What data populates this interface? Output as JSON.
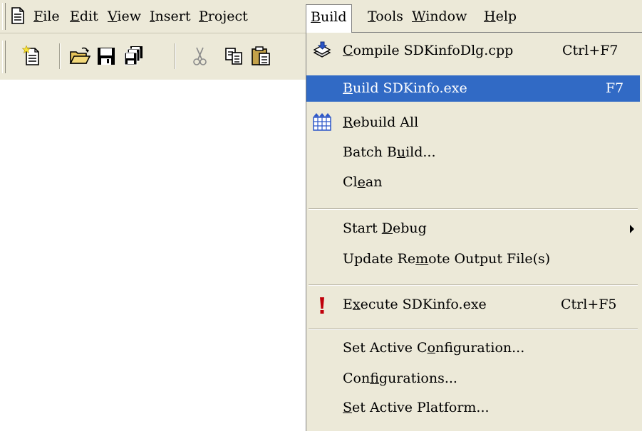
{
  "menubar": {
    "items": [
      {
        "id": "file",
        "before": "",
        "key": "F",
        "after": "ile"
      },
      {
        "id": "edit",
        "before": "",
        "key": "E",
        "after": "dit"
      },
      {
        "id": "view",
        "before": "",
        "key": "V",
        "after": "iew"
      },
      {
        "id": "insert",
        "before": "",
        "key": "I",
        "after": "nsert"
      },
      {
        "id": "project",
        "before": "",
        "key": "P",
        "after": "roject"
      },
      {
        "id": "build",
        "before": "",
        "key": "B",
        "after": "uild"
      },
      {
        "id": "tools",
        "before": "",
        "key": "T",
        "after": "ools"
      },
      {
        "id": "window",
        "before": "",
        "key": "W",
        "after": "indow"
      },
      {
        "id": "help",
        "before": "",
        "key": "H",
        "after": "elp"
      }
    ]
  },
  "toolbar": {
    "buttons": [
      "new-text-file-icon",
      "open-folder-icon",
      "save-icon",
      "save-all-icon",
      "cut-icon",
      "copy-icon",
      "paste-icon"
    ]
  },
  "build_menu": {
    "items": [
      {
        "id": "compile",
        "before": "",
        "key": "C",
        "after": "ompile SDKinfoDlg.cpp",
        "shortcut": "Ctrl+F7",
        "icon": "compile-icon"
      },
      {
        "id": "build",
        "before": "",
        "key": "B",
        "after": "uild SDKinfo.exe",
        "shortcut": "F7",
        "highlighted": true
      },
      {
        "id": "rebuild-all",
        "before": "",
        "key": "R",
        "after": "ebuild All",
        "icon": "rebuild-all-icon"
      },
      {
        "id": "batch-build",
        "before": "Batch B",
        "key": "u",
        "after": "ild..."
      },
      {
        "id": "clean",
        "before": "Cl",
        "key": "e",
        "after": "an"
      },
      {
        "id": "start-debug",
        "before": "Start ",
        "key": "D",
        "after": "ebug",
        "submenu": true
      },
      {
        "id": "update-remote",
        "before": "Update Re",
        "key": "m",
        "after": "ote Output File(s)"
      },
      {
        "id": "execute",
        "before": "E",
        "key": "x",
        "after": "ecute SDKinfo.exe",
        "shortcut": "Ctrl+F5",
        "icon": "execute-icon"
      },
      {
        "id": "set-active-config",
        "before": "Set Active C",
        "key": "o",
        "after": "nfiguration..."
      },
      {
        "id": "configurations",
        "before": "Con",
        "key": "f",
        "after": "igurations..."
      },
      {
        "id": "set-active-platform",
        "before": "",
        "key": "S",
        "after": "et Active Platform..."
      }
    ]
  },
  "colors": {
    "menu_bg": "#ece9d8",
    "highlight": "#316ac5",
    "highlight_text": "#ffffff",
    "execute_icon": "#c0000b"
  }
}
